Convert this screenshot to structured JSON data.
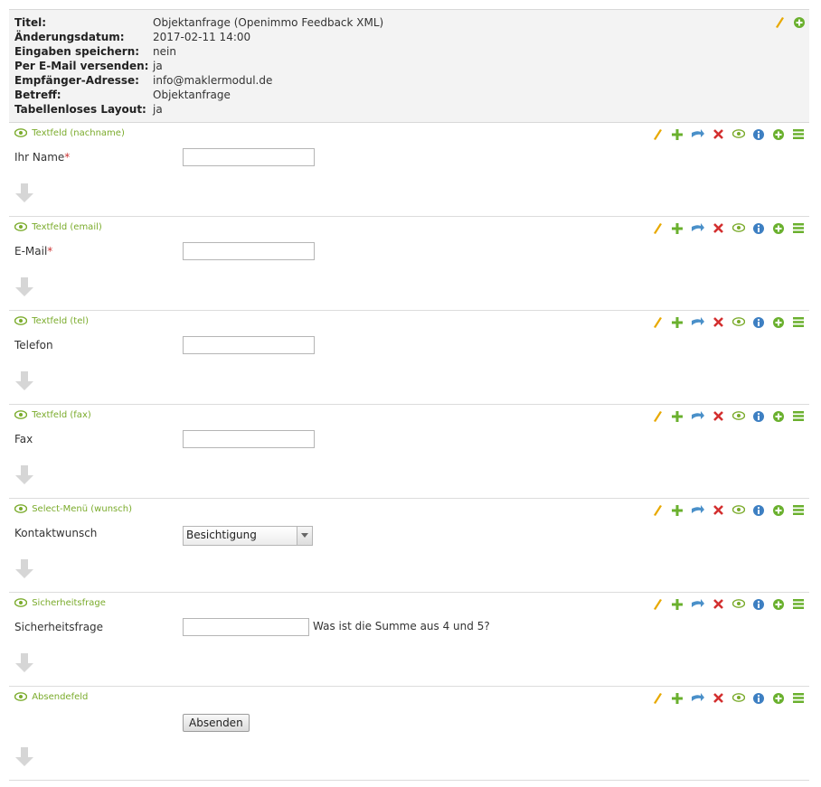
{
  "form_info": {
    "rows": [
      {
        "label": "Titel:",
        "value": "Objektanfrage (Openimmo Feedback XML)"
      },
      {
        "label": "Änderungsdatum:",
        "value": "2017-02-11 14:00"
      },
      {
        "label": "Eingaben speichern:",
        "value": "nein"
      },
      {
        "label": "Per E-Mail versenden:",
        "value": "ja"
      },
      {
        "label": "Empfänger-Adresse:",
        "value": "info@maklermodul.de"
      },
      {
        "label": "Betreff:",
        "value": "Objektanfrage"
      },
      {
        "label": "Tabellenloses Layout:",
        "value": "ja"
      }
    ],
    "icons": [
      "pencil-icon",
      "add-circle-icon"
    ]
  },
  "field_icons": [
    "pencil-icon",
    "plus-icon",
    "move-icon",
    "delete-icon",
    "eye-icon",
    "info-icon",
    "add-circle-icon",
    "drag-handle-icon"
  ],
  "colors": {
    "accent_green": "#7aab2b",
    "pencil": "#e8a900",
    "delete": "#d32f2f",
    "info": "#3d7fc2",
    "move": "#4a90c9"
  },
  "fields": [
    {
      "title": "Textfeld (nachname)",
      "label": "Ihr Name",
      "required": "*",
      "type": "text",
      "value": ""
    },
    {
      "title": "Textfeld (email)",
      "label": "E-Mail",
      "required": "*",
      "type": "text",
      "value": ""
    },
    {
      "title": "Textfeld (tel)",
      "label": "Telefon",
      "required": "",
      "type": "text",
      "value": ""
    },
    {
      "title": "Textfeld (fax)",
      "label": "Fax",
      "required": "",
      "type": "text",
      "value": ""
    },
    {
      "title": "Select-Menü (wunsch)",
      "label": "Kontaktwunsch",
      "required": "",
      "type": "select",
      "value": "Besichtigung"
    },
    {
      "title": "Sicherheitsfrage",
      "label": "Sicherheitsfrage",
      "required": "",
      "type": "captcha",
      "value": "",
      "hint": "Was ist die Summe aus 4 und 5?"
    },
    {
      "title": "Absendefeld",
      "label": "",
      "required": "",
      "type": "submit",
      "value": "Absenden"
    }
  ]
}
